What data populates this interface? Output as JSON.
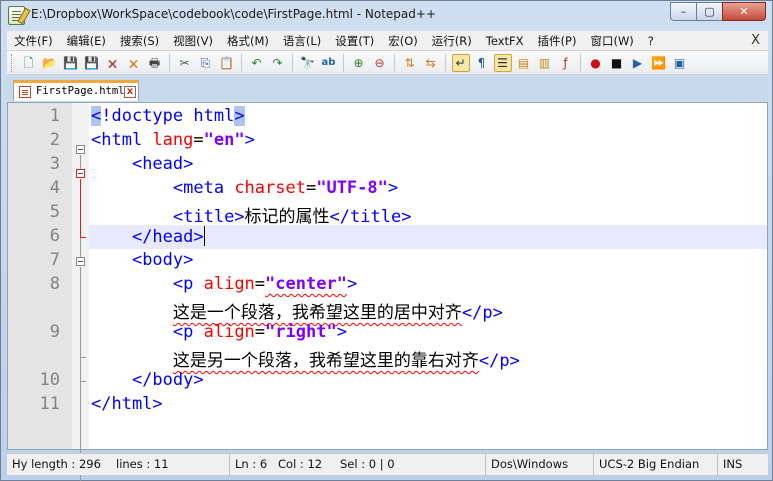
{
  "window": {
    "title": "E:\\Dropbox\\WorkSpace\\codebook\\code\\FirstPage.html - Notepad++",
    "minimize": "–",
    "maximize": "▢",
    "close": "✕"
  },
  "menu": {
    "items": [
      "文件(F)",
      "编辑(E)",
      "搜索(S)",
      "视图(V)",
      "格式(M)",
      "语言(L)",
      "设置(T)",
      "宏(O)",
      "运行(R)",
      "TextFX",
      "插件(P)",
      "窗口(W)",
      "?"
    ],
    "close": "X"
  },
  "toolbar": {
    "icons": [
      {
        "name": "new-file-icon",
        "glyph": "🗋",
        "color": "#2e7d32"
      },
      {
        "name": "open-file-icon",
        "glyph": "📂",
        "color": "#c68a0c"
      },
      {
        "name": "save-icon",
        "glyph": "💾",
        "color": "#1f4fa3"
      },
      {
        "name": "save-all-icon",
        "glyph": "💾",
        "color": "#1f4fa3"
      },
      {
        "name": "close-file-icon",
        "glyph": "🗙",
        "color": "#b3321c"
      },
      {
        "name": "close-all-icon",
        "glyph": "🗙",
        "color": "#d77a1a"
      },
      {
        "name": "print-icon",
        "glyph": "🖶",
        "color": "#444444"
      },
      {
        "name": "sep"
      },
      {
        "name": "cut-icon",
        "glyph": "✂",
        "color": "#555555"
      },
      {
        "name": "copy-icon",
        "glyph": "⎘",
        "color": "#3a5f9a"
      },
      {
        "name": "paste-icon",
        "glyph": "📋",
        "color": "#8b6a2a"
      },
      {
        "name": "sep"
      },
      {
        "name": "undo-icon",
        "glyph": "↶",
        "color": "#2e7d32"
      },
      {
        "name": "redo-icon",
        "glyph": "↷",
        "color": "#2e7d32"
      },
      {
        "name": "sep"
      },
      {
        "name": "find-icon",
        "glyph": "🔭",
        "color": "#333333"
      },
      {
        "name": "replace-icon",
        "glyph": "ab",
        "color": "#2260a8"
      },
      {
        "name": "sep"
      },
      {
        "name": "zoom-in-icon",
        "glyph": "⊕",
        "color": "#2e7d32"
      },
      {
        "name": "zoom-out-icon",
        "glyph": "⊖",
        "color": "#b3321c"
      },
      {
        "name": "sep"
      },
      {
        "name": "sync-vertical-icon",
        "glyph": "⇅",
        "color": "#d77a1a"
      },
      {
        "name": "sync-horizontal-icon",
        "glyph": "⇆",
        "color": "#d77a1a"
      },
      {
        "name": "sep"
      },
      {
        "name": "word-wrap-icon",
        "glyph": "↵",
        "color": "#333333",
        "active": true
      },
      {
        "name": "show-all-chars-icon",
        "glyph": "¶",
        "color": "#2260a8"
      },
      {
        "name": "indent-guide-icon",
        "glyph": "☰",
        "color": "#333333",
        "active": true
      },
      {
        "name": "user-lang-icon",
        "glyph": "▤",
        "color": "#c68a0c"
      },
      {
        "name": "doc-map-icon",
        "glyph": "▥",
        "color": "#c68a0c"
      },
      {
        "name": "function-list-icon",
        "glyph": "ƒ",
        "color": "#b3321c"
      },
      {
        "name": "sep"
      },
      {
        "name": "record-macro-icon",
        "glyph": "●",
        "color": "#d01010"
      },
      {
        "name": "stop-macro-icon",
        "glyph": "■",
        "color": "#111111"
      },
      {
        "name": "play-macro-icon",
        "glyph": "▶",
        "color": "#2260a8"
      },
      {
        "name": "run-macro-multiple-icon",
        "glyph": "⏩",
        "color": "#2260a8"
      },
      {
        "name": "save-macro-icon",
        "glyph": "▣",
        "color": "#2260a8"
      }
    ]
  },
  "tab": {
    "label": "FirstPage.html",
    "close": "x"
  },
  "editor": {
    "line_numbers": [
      "1",
      "2",
      "3",
      "4",
      "5",
      "6",
      "7",
      "8",
      "",
      "9",
      "",
      "10",
      "11"
    ],
    "lines": [
      {
        "n": "1",
        "tokens": [
          {
            "t": "tag",
            "v": "<",
            "hl": true
          },
          {
            "t": "tag",
            "v": "!doctype html"
          },
          {
            "t": "tag",
            "v": ">",
            "hl": true
          }
        ]
      },
      {
        "n": "2",
        "tokens": [
          {
            "t": "tag",
            "v": "<html "
          },
          {
            "t": "attr",
            "v": "lang"
          },
          {
            "t": "eq",
            "v": "="
          },
          {
            "t": "val",
            "v": "\"en\""
          },
          {
            "t": "tag",
            "v": ">"
          }
        ]
      },
      {
        "n": "3",
        "tokens": [
          {
            "t": "sp",
            "v": "    "
          },
          {
            "t": "tag",
            "v": "<head>"
          }
        ]
      },
      {
        "n": "4",
        "tokens": [
          {
            "t": "sp",
            "v": "        "
          },
          {
            "t": "tag",
            "v": "<meta "
          },
          {
            "t": "attr",
            "v": "charset"
          },
          {
            "t": "eq",
            "v": "="
          },
          {
            "t": "val",
            "v": "\"UTF-8\""
          },
          {
            "t": "tag",
            "v": ">"
          }
        ]
      },
      {
        "n": "5",
        "tokens": [
          {
            "t": "sp",
            "v": "        "
          },
          {
            "t": "tag",
            "v": "<title>"
          },
          {
            "t": "txt",
            "v": "标记的属性",
            "sq": true
          },
          {
            "t": "tag",
            "v": "</title>"
          }
        ]
      },
      {
        "n": "6",
        "tokens": [
          {
            "t": "sp",
            "v": "    "
          },
          {
            "t": "tag",
            "v": "</head>"
          },
          {
            "t": "caret",
            "v": ""
          }
        ]
      },
      {
        "n": "7",
        "tokens": [
          {
            "t": "sp",
            "v": "    "
          },
          {
            "t": "tag",
            "v": "<body>"
          }
        ]
      },
      {
        "n": "8",
        "tokens": [
          {
            "t": "sp",
            "v": "        "
          },
          {
            "t": "tag",
            "v": "<p "
          },
          {
            "t": "attr",
            "v": "align"
          },
          {
            "t": "eq",
            "v": "="
          },
          {
            "t": "val",
            "v": "\"center\"",
            "sq": true
          },
          {
            "t": "tag",
            "v": ">"
          }
        ]
      },
      {
        "n": "",
        "tokens": [
          {
            "t": "sp",
            "v": "        "
          },
          {
            "t": "txt",
            "v": "这是一个段落，我希望这里的居中对齐",
            "sq": true
          },
          {
            "t": "tag",
            "v": "</p>"
          }
        ]
      },
      {
        "n": "9",
        "tokens": [
          {
            "t": "sp",
            "v": "        "
          },
          {
            "t": "tag",
            "v": "<p "
          },
          {
            "t": "attr",
            "v": "align"
          },
          {
            "t": "eq",
            "v": "="
          },
          {
            "t": "val",
            "v": "\"right\""
          },
          {
            "t": "tag",
            "v": ">"
          }
        ]
      },
      {
        "n": "",
        "tokens": [
          {
            "t": "sp",
            "v": "        "
          },
          {
            "t": "txt",
            "v": "这是另一个段落，我希望这里的靠右对齐",
            "sq": true
          },
          {
            "t": "tag",
            "v": "</p>"
          }
        ]
      },
      {
        "n": "10",
        "tokens": [
          {
            "t": "sp",
            "v": "    "
          },
          {
            "t": "tag",
            "v": "</body>"
          }
        ]
      },
      {
        "n": "11",
        "tokens": [
          {
            "t": "tag",
            "v": "</html>"
          }
        ]
      }
    ],
    "current_line_index": 5
  },
  "status": {
    "length": "Hy length : 296",
    "lines": "lines : 11",
    "ln": "Ln : 6",
    "col": "Col : 12",
    "sel": "Sel : 0 | 0",
    "eol": "Dos\\Windows",
    "encoding": "UCS-2 Big Endian",
    "mode": "INS"
  },
  "colors": {
    "tag": "#0000ff",
    "attr": "#ff0000",
    "value": "#8000ff",
    "current_line": "#e8e8ff",
    "tab_accent": "#f2a93b"
  }
}
